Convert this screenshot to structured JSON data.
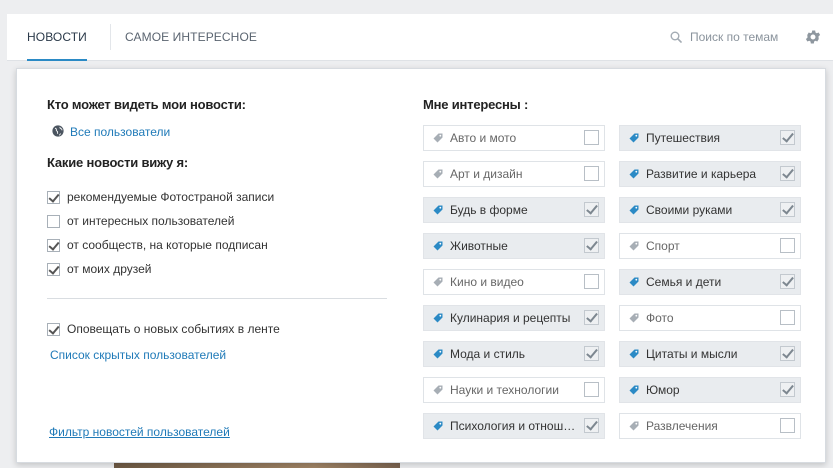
{
  "tabs": [
    {
      "label": "Новости",
      "active": true
    },
    {
      "label": "Самое интересное",
      "active": false
    }
  ],
  "search": {
    "placeholder": "Поиск по темам",
    "icon": "search-icon"
  },
  "settings": {
    "icon": "gear-icon"
  },
  "visibility": {
    "heading": "Кто может видеть мои новости:",
    "value": "Все пользователи",
    "icon": "globe-icon"
  },
  "feed": {
    "heading": "Какие новости вижу я:",
    "options": [
      {
        "label": "рекомендуемые Фотостраной записи",
        "checked": true
      },
      {
        "label": "от интересных пользователей",
        "checked": false
      },
      {
        "label": "от сообществ, на которые подписан",
        "checked": true
      },
      {
        "label": "от моих друзей",
        "checked": true
      }
    ]
  },
  "notify": {
    "label": "Оповещать о новых событиях в ленте",
    "checked": true
  },
  "hidden_users_link": "Список скрытых пользователей",
  "filter_link": "Фильтр новостей пользователей",
  "interests": {
    "heading": "Мне интересны :",
    "left": [
      {
        "label": "Авто и мото",
        "checked": false
      },
      {
        "label": "Арт и дизайн",
        "checked": false
      },
      {
        "label": "Будь в форме",
        "checked": true
      },
      {
        "label": "Животные",
        "checked": true
      },
      {
        "label": "Кино и видео",
        "checked": false
      },
      {
        "label": "Кулинария и рецепты",
        "checked": true
      },
      {
        "label": "Мода и стиль",
        "checked": true
      },
      {
        "label": "Науки и технологии",
        "checked": false
      },
      {
        "label": "Психология и отнош…",
        "checked": true
      }
    ],
    "right": [
      {
        "label": "Путешествия",
        "checked": true
      },
      {
        "label": "Развитие и карьера",
        "checked": true
      },
      {
        "label": "Своими руками",
        "checked": true
      },
      {
        "label": "Спорт",
        "checked": false
      },
      {
        "label": "Семья и дети",
        "checked": true
      },
      {
        "label": "Фото",
        "checked": false
      },
      {
        "label": "Цитаты и мысли",
        "checked": true
      },
      {
        "label": "Юмор",
        "checked": true
      },
      {
        "label": "Развлечения",
        "checked": false
      }
    ],
    "tag_color_on": "#2b8ac5",
    "tag_color_off": "#a7aeb5"
  }
}
